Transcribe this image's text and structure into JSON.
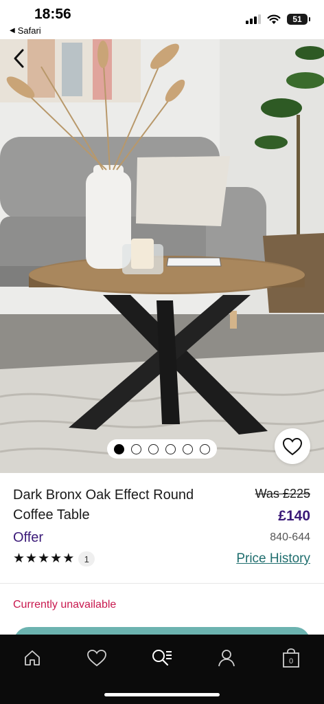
{
  "status_bar": {
    "time": "18:56",
    "back_app": "Safari",
    "battery": "51"
  },
  "hero": {
    "image_icon": "coffee-table-photo",
    "carousel": {
      "count": 6,
      "active_index": 0
    },
    "back_icon": "chevron-left-icon",
    "favourite_icon": "heart-outline-icon"
  },
  "product": {
    "title": "Dark Bronx Oak Effect Round Coffee Table",
    "was_price": "Was £225",
    "price": "£140",
    "offer_label": "Offer",
    "code": "840-644",
    "rating": {
      "stars": 5,
      "count": "1"
    },
    "price_history_label": "Price History",
    "availability": "Currently unavailable"
  },
  "colors": {
    "price": "#3b1a78",
    "link": "#1f6e6e",
    "unavailable": "#c8174d",
    "cta": "#6cb3b0",
    "nav_bg": "#0b0b0b"
  },
  "bottom_nav": {
    "items": [
      {
        "icon": "home-icon"
      },
      {
        "icon": "heart-icon"
      },
      {
        "icon": "search-list-icon"
      },
      {
        "icon": "account-icon"
      },
      {
        "icon": "bag-icon",
        "badge": "0"
      }
    ]
  }
}
